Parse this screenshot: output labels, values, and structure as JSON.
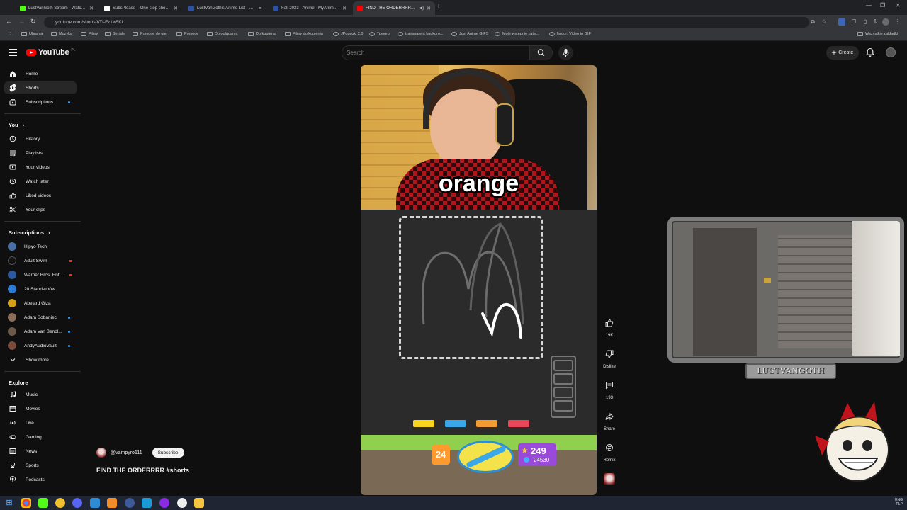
{
  "browser": {
    "tabs": [
      {
        "title": "LustVanGoth Stream - Watch Li...",
        "color": "#53fc18",
        "active": false
      },
      {
        "title": "SubsPlease – One stop shop fo...",
        "color": "#ffffff",
        "active": false
      },
      {
        "title": "LustVanGoth's Anime List - My...",
        "color": "#2e51a2",
        "active": false
      },
      {
        "title": "Fall 2023 - Anime - MyAnimeLi...",
        "color": "#2e51a2",
        "active": false
      },
      {
        "title": "FIND THE ORDERRRR #sho...",
        "color": "#ff0000",
        "active": true
      }
    ],
    "url": "youtube.com/shorts/8TI-Fz1w5KI",
    "bookmarks": [
      "Ubrania",
      "Muzyka",
      "Filmy",
      "Seriale",
      "Pomoce do gier",
      "Pomoce",
      "Do oglądania",
      "Do kupienia",
      "Filmy do kupienia",
      "JPopsuki 2.0",
      "Трекер",
      "transparent backgro...",
      "Just Anime GIFS",
      "Moje wstępnie zatw...",
      "Imgur: Video to GIF"
    ],
    "bookmarks_right": "Wszystkie zakładki"
  },
  "header": {
    "logo_text": "YouTube",
    "region": "PL",
    "search_placeholder": "Search",
    "create_label": "Create"
  },
  "sidebar": {
    "main": [
      {
        "label": "Home",
        "icon": "home-icon"
      },
      {
        "label": "Shorts",
        "icon": "shorts-icon",
        "active": true
      },
      {
        "label": "Subscriptions",
        "icon": "subscriptions-icon"
      }
    ],
    "you_heading": "You",
    "you": [
      {
        "label": "History",
        "icon": "history-icon"
      },
      {
        "label": "Playlists",
        "icon": "playlists-icon"
      },
      {
        "label": "Your videos",
        "icon": "your-videos-icon"
      },
      {
        "label": "Watch later",
        "icon": "watch-later-icon"
      },
      {
        "label": "Liked videos",
        "icon": "liked-videos-icon"
      },
      {
        "label": "Your clips",
        "icon": "scissors-icon"
      }
    ],
    "subscriptions_heading": "Subscriptions",
    "channels": [
      {
        "label": "Hipyo Tech",
        "color": "#4a6fa5",
        "badge": "none"
      },
      {
        "label": "Adult Swim",
        "color": "#111111",
        "badge": "live"
      },
      {
        "label": "Warner Bros. Ent...",
        "color": "#2c5aa0",
        "badge": "live"
      },
      {
        "label": "20 Stand-upów",
        "color": "#2b7bd6",
        "badge": "none"
      },
      {
        "label": "Abelard Giza",
        "color": "#d4a017",
        "badge": "none"
      },
      {
        "label": "Adam Sobaniec",
        "color": "#8b6f5a",
        "badge": "dot"
      },
      {
        "label": "Adam Van Bendl...",
        "color": "#6b5a4a",
        "badge": "dot"
      },
      {
        "label": "AndyAudioVault",
        "color": "#7a4a3a",
        "badge": "dot"
      }
    ],
    "show_more": "Show more",
    "explore_heading": "Explore",
    "explore": [
      {
        "label": "Music",
        "icon": "music-icon"
      },
      {
        "label": "Movies",
        "icon": "movies-icon"
      },
      {
        "label": "Live",
        "icon": "live-icon"
      },
      {
        "label": "Gaming",
        "icon": "gaming-icon"
      },
      {
        "label": "News",
        "icon": "news-icon"
      },
      {
        "label": "Sports",
        "icon": "sports-icon"
      },
      {
        "label": "Podcasts",
        "icon": "podcasts-icon"
      }
    ]
  },
  "short": {
    "caption": "orange",
    "channel": "@vampyro111",
    "subscribe_label": "Subscribe",
    "title": "FIND THE ORDERRRR #shorts",
    "game": {
      "level": "24",
      "stars": "249",
      "coins": "24530",
      "colors": [
        "#f7d41e",
        "#3aa7e8",
        "#f39c33",
        "#e8475a"
      ]
    },
    "progress": 0.2
  },
  "actions": [
    {
      "label": "19K",
      "icon": "like-icon"
    },
    {
      "label": "Dislike",
      "icon": "dislike-icon"
    },
    {
      "label": "193",
      "icon": "comment-icon"
    },
    {
      "label": "Share",
      "icon": "share-icon"
    },
    {
      "label": "Remix",
      "icon": "remix-icon"
    }
  ],
  "overlay": {
    "plate_text": "LUSTVANGOTH"
  },
  "taskbar": {
    "lang": "ENG",
    "locale": "PLP"
  }
}
